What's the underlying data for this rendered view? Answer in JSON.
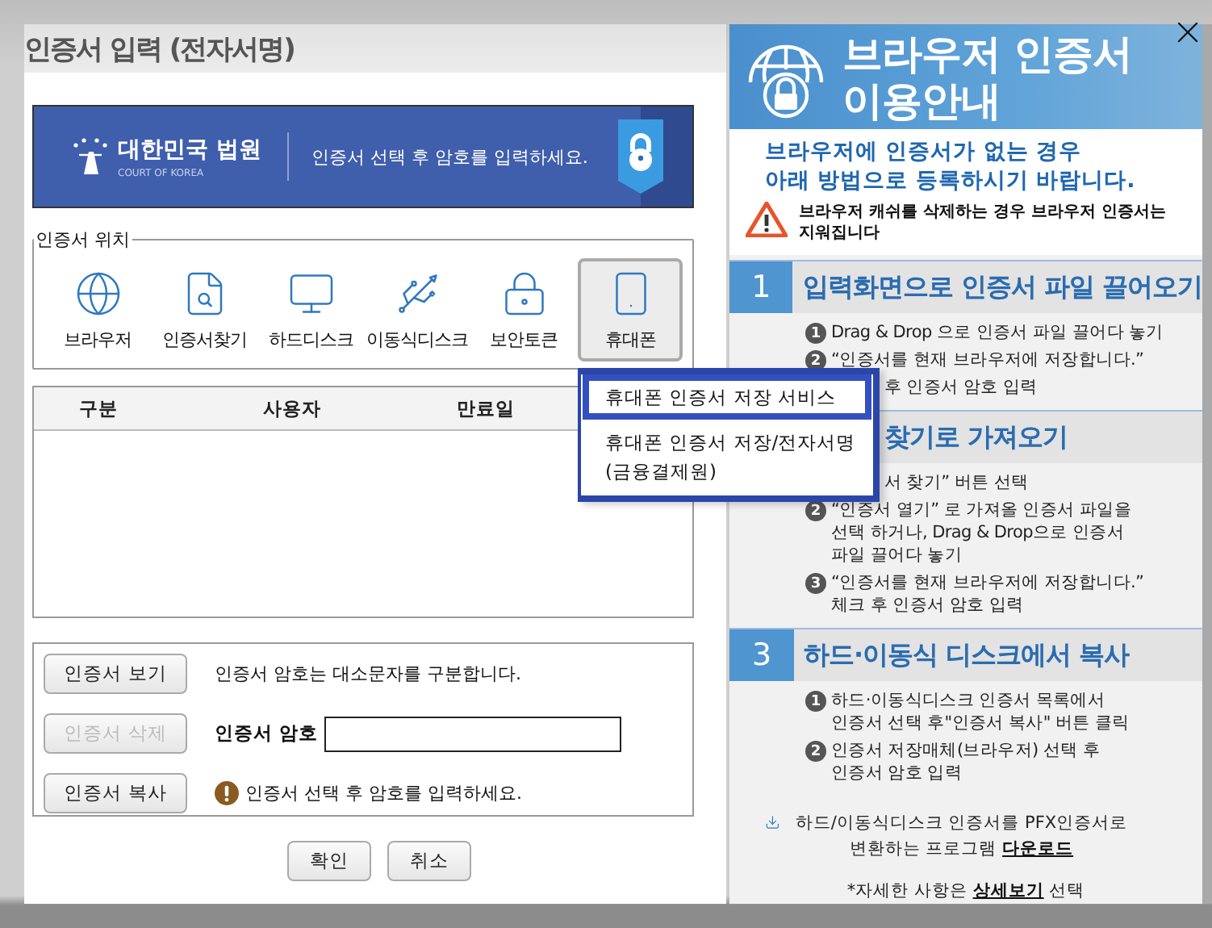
{
  "dialog": {
    "title": "인증서 입력 (전자서명)",
    "banner": {
      "org_name": "대한민국 법원",
      "org_name_en": "COURT OF KOREA",
      "message": "인증서 선택 후 암호를 입력하세요."
    },
    "location": {
      "legend": "인증서 위치",
      "options": [
        {
          "label": "브라우저",
          "selected": false
        },
        {
          "label": "인증서찾기",
          "selected": false
        },
        {
          "label": "하드디스크",
          "selected": false
        },
        {
          "label": "이동식디스크",
          "selected": false
        },
        {
          "label": "보안토큰",
          "selected": false
        },
        {
          "label": "휴대폰",
          "selected": true
        }
      ]
    },
    "table": {
      "columns": [
        "구분",
        "사용자",
        "만료일"
      ]
    },
    "actions": [
      {
        "label": "인증서 보기",
        "disabled": false
      },
      {
        "label": "인증서 삭제",
        "disabled": true
      },
      {
        "label": "인증서 복사",
        "disabled": false
      }
    ],
    "case_note": "인증서 암호는 대소문자를 구분합니다.",
    "password": {
      "label": "인증서 암호"
    },
    "hint": "인증서 선택 후 암호를 입력하세요.",
    "buttons": [
      "확인",
      "취소"
    ]
  },
  "phone_menu": {
    "items": [
      {
        "lines": [
          "휴대폰 인증서 저장 서비스"
        ],
        "selected": true
      },
      {
        "lines": [
          "휴대폰 인증서 저장/전자서명",
          "(금융결제원)"
        ],
        "selected": false
      }
    ]
  },
  "guide": {
    "title": [
      "브라우저 인증서",
      "이용안내"
    ],
    "intro": [
      "브라우저에 인증서가 없는 경우",
      "아래 방법으로 등록하시기 바랍니다."
    ],
    "warning": "브라우저 캐쉬를 삭제하는 경우 브라우저 인증서는 지워집니다",
    "sections": [
      {
        "number": "1",
        "title": "입력화면으로 인증서 파일 끌어오기",
        "steps": [
          {
            "number": "1",
            "lines": [
              "Drag & Drop 으로 인증서 파일 끌어다 놓기"
            ]
          },
          {
            "number": "2",
            "lines": [
              "“인증서를 현재 브라우저에 저장합니다.”"
            ]
          },
          {
            "lines": [
              "후 인증서 암호 입력"
            ]
          }
        ]
      },
      {
        "title": "찾기로 가져오기",
        "steps": [
          {
            "lines": [
              "서 찾기” 버튼 선택"
            ]
          },
          {
            "number": "2",
            "lines": [
              "“인증서 열기” 로 가져올 인증서 파일을",
              "선택 하거나, Drag & Drop으로 인증서",
              "파일 끌어다 놓기"
            ]
          },
          {
            "number": "3",
            "lines": [
              "“인증서를 현재 브라우저에 저장합니다.”",
              "체크 후 인증서 암호 입력"
            ]
          }
        ]
      },
      {
        "number": "3",
        "title": "하드·이동식 디스크에서 복사",
        "steps": [
          {
            "number": "1",
            "lines": [
              "하드·이동식디스크 인증서 목록에서",
              "인증서 선택 후\"인증서 복사\" 버튼 클릭"
            ]
          },
          {
            "number": "2",
            "lines": [
              "인증서 저장매체(브라우저) 선택 후",
              "인증서 암호 입력"
            ]
          }
        ]
      }
    ],
    "download": {
      "text": "하드/이동식디스크 인증서를 PFX인증서로 변환하는 프로그램",
      "link": "다운로드"
    },
    "detail": {
      "before": "*자세한 사항은",
      "link": "상세보기",
      "after": "선택"
    }
  }
}
